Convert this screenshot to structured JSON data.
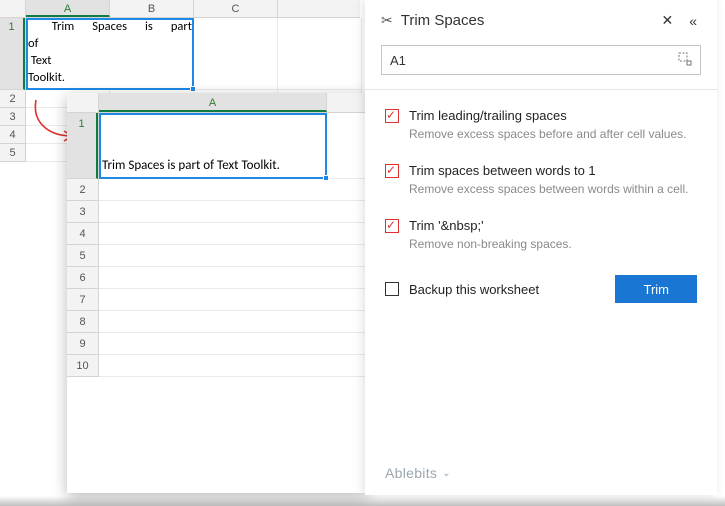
{
  "panel": {
    "title": "Trim Spaces",
    "range_value": "A1",
    "options": [
      {
        "label": "Trim leading/trailing spaces",
        "desc": "Remove excess spaces before and after cell values.",
        "checked": true
      },
      {
        "label": "Trim spaces between words to 1",
        "desc": "Remove excess spaces between words within a cell.",
        "checked": true
      },
      {
        "label": "Trim '&nbsp;'",
        "desc": "Remove non-breaking spaces.",
        "checked": true
      }
    ],
    "backup_label": "Backup this worksheet",
    "trim_button": "Trim",
    "brand": "Ablebits"
  },
  "sheet1": {
    "cols": [
      "A",
      "B",
      "C"
    ],
    "rows": [
      "1",
      "2",
      "3",
      "4",
      "5"
    ],
    "text_line1_a": "Trim",
    "text_line1_b": "Spaces",
    "text_line1_c": "is",
    "text_line1_d": "part",
    "text_line2": "of",
    "text_line3": " Text",
    "text_line4": "Toolkit."
  },
  "sheet2": {
    "col": "A",
    "rows": [
      "1",
      "2",
      "3",
      "4",
      "5",
      "6",
      "7",
      "8",
      "9",
      "10"
    ],
    "result": "Trim Spaces is part of Text Toolkit."
  }
}
